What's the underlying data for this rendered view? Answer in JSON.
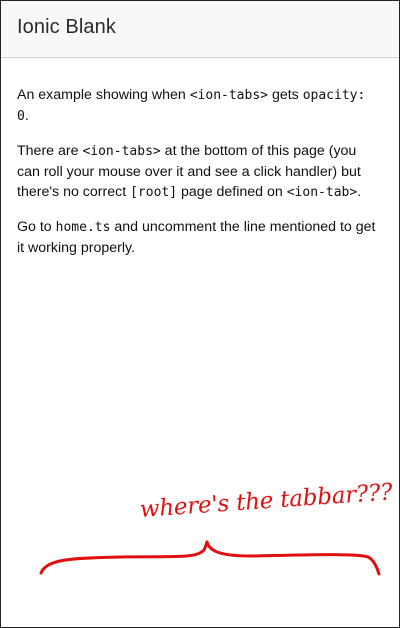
{
  "toolbar": {
    "title": "Ionic Blank"
  },
  "content": {
    "p1": {
      "text1": "An example showing when ",
      "code1": "<ion-tabs>",
      "text2": " gets ",
      "code2": "opacity: 0",
      "text3": "."
    },
    "p2": {
      "text1": "There are ",
      "code1": "<ion-tabs>",
      "text2": " at the bottom of this page (you can roll your mouse over it and see a click handler) but there's no correct ",
      "code2": "[root]",
      "text3": " page defined on ",
      "code3": "<ion-tab>",
      "text4": "."
    },
    "p3": {
      "text1": "Go to ",
      "code1": "home.ts",
      "text2": " and uncomment the line mentioned to get it working properly."
    }
  },
  "annotation": {
    "text": "where's the tabbar???",
    "color": "#e01010"
  }
}
